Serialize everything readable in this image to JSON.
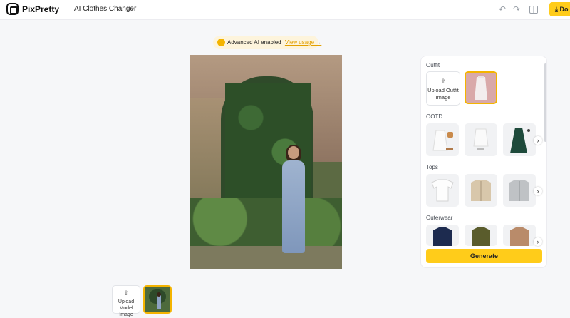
{
  "header": {
    "brand": "PixPretty",
    "tool": "AI Clothes Changer",
    "download_label": "Do",
    "accent": "#ffcc1a"
  },
  "icons": {
    "logo": "square-logo-icon",
    "tool_dropdown": "chevron-down-icon",
    "undo": "undo-icon",
    "redo": "redo-icon",
    "compare": "split-view-icon",
    "download": "download-icon",
    "badge": "sparkle-icon",
    "upload": "upload-icon",
    "next": "chevron-right-icon"
  },
  "badge": {
    "text": "Advanced AI enabled",
    "link": "View usage →"
  },
  "panel": {
    "outfit_title": "Outfit",
    "upload_outfit": "Upload Outfit Image",
    "ootd_title": "OOTD",
    "tops_title": "Tops",
    "outerwear_title": "Outerwear",
    "generate": "Generate"
  },
  "bottom": {
    "upload_model": "Upload Model Image"
  }
}
